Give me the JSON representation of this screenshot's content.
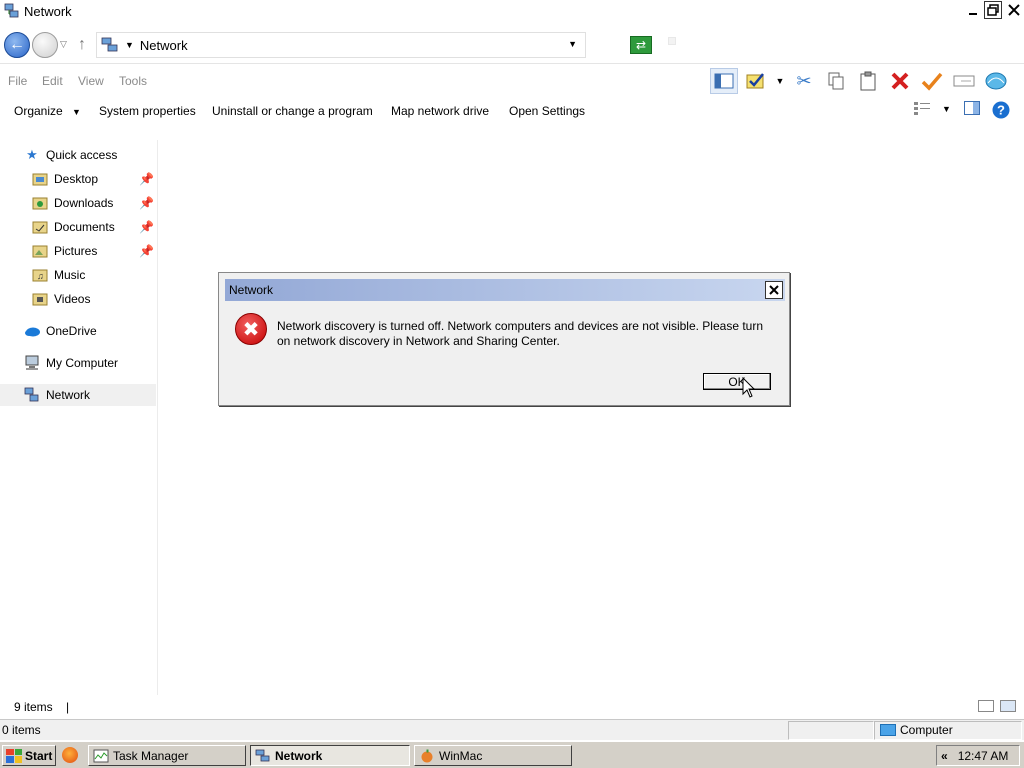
{
  "window": {
    "title": "Network"
  },
  "address": {
    "location": "Network"
  },
  "menu": {
    "file": "File",
    "edit": "Edit",
    "view": "View",
    "tools": "Tools"
  },
  "commands": {
    "organize": "Organize",
    "system_properties": "System properties",
    "uninstall": "Uninstall or change a program",
    "map_drive": "Map network drive",
    "open_settings": "Open Settings"
  },
  "sidebar": {
    "items": [
      {
        "label": "Quick access",
        "icon": "star-icon"
      },
      {
        "label": "Desktop",
        "icon": "desktop-folder-icon",
        "pinned": true
      },
      {
        "label": "Downloads",
        "icon": "downloads-folder-icon",
        "pinned": true
      },
      {
        "label": "Documents",
        "icon": "documents-folder-icon",
        "pinned": true
      },
      {
        "label": "Pictures",
        "icon": "pictures-folder-icon",
        "pinned": true
      },
      {
        "label": "Music",
        "icon": "music-folder-icon"
      },
      {
        "label": "Videos",
        "icon": "videos-folder-icon"
      },
      {
        "label": "OneDrive",
        "icon": "onedrive-cloud-icon"
      },
      {
        "label": "My Computer",
        "icon": "computer-icon"
      },
      {
        "label": "Network",
        "icon": "network-icon",
        "selected": true
      }
    ]
  },
  "dialog": {
    "title": "Network",
    "message": "Network discovery is turned off. Network computers and devices are not visible. Please turn on network discovery in Network and Sharing Center.",
    "ok_label": "OK",
    "icon": "error-icon"
  },
  "status": {
    "item_count": "9 items",
    "selected_count": "0 items",
    "zone": "Computer"
  },
  "taskbar": {
    "start_label": "Start",
    "tasks": [
      {
        "label": "Task Manager",
        "active": false
      },
      {
        "label": "Network",
        "active": true
      },
      {
        "label": "WinMac",
        "active": false
      }
    ],
    "clock": "12:47 AM",
    "tray_chevron": "«"
  },
  "colors": {
    "dialog_title_start": "#93a8d6",
    "dialog_title_end": "#c8d6ef",
    "error_red": "#d40000",
    "accent_blue": "#2b78d0",
    "taskbar": "#d4d0c8"
  }
}
